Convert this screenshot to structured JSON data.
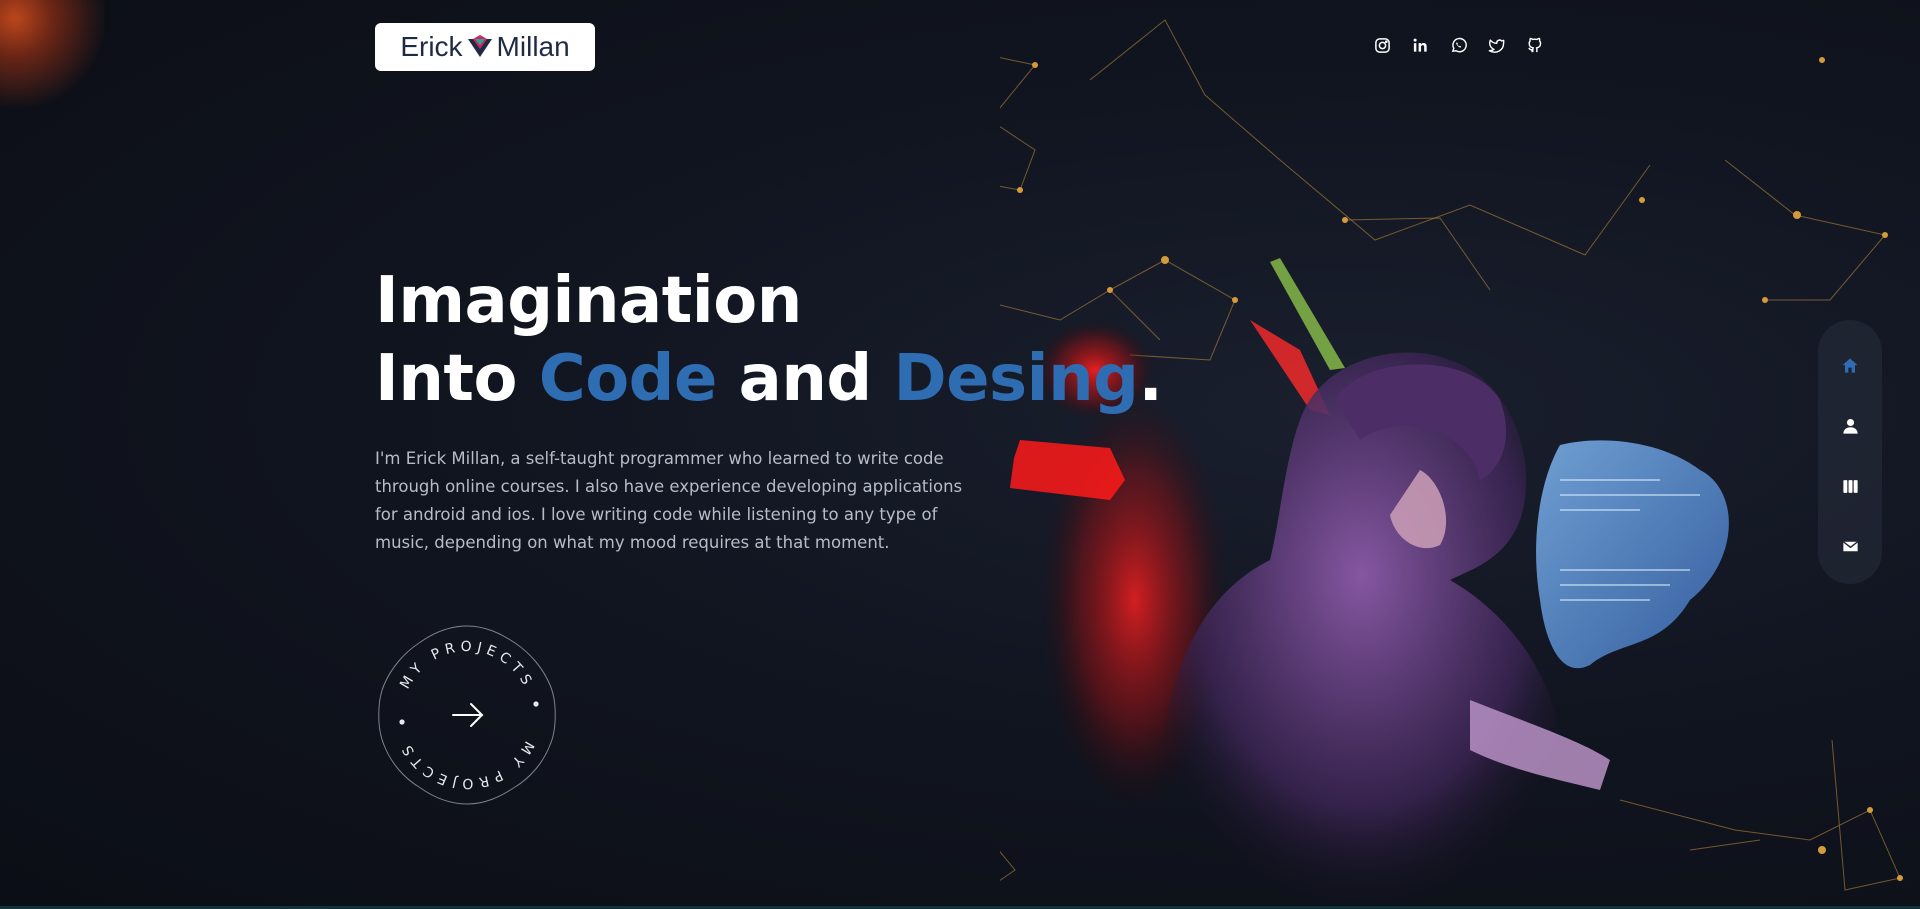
{
  "header": {
    "logo": {
      "first": "Erick",
      "last": "Millan"
    },
    "social": [
      "instagram-icon",
      "linkedin-icon",
      "whatsapp-icon",
      "twitter-icon",
      "github-icon"
    ]
  },
  "hero": {
    "line1": "Imagination",
    "line2_a": "Into ",
    "line2_b": "Code",
    "line2_c": " and ",
    "line2_d": "Desing",
    "line2_e": ".",
    "description": "I'm Erick Millan, a self-taught programmer who learned to write code through online courses. I also have experience developing applications for android and ios. I love writing code while listening to any type of music, depending on what my mood requires at that moment."
  },
  "projects_button": {
    "label": "MY PROJECTS"
  },
  "side_nav": {
    "items": [
      "home-icon",
      "user-icon",
      "projects-icon",
      "mail-icon"
    ],
    "active": "home-icon"
  },
  "colors": {
    "accent": "#2f6db3",
    "background": "#111520",
    "network": "#d59b3a",
    "glow": "#ff2a2a"
  }
}
